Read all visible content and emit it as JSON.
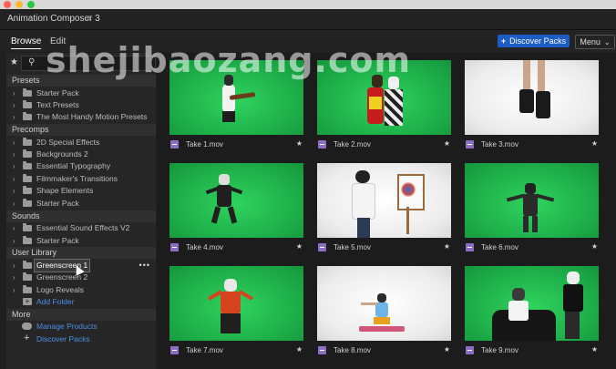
{
  "window": {
    "title": "Animation Composer 3",
    "menu_icon": "hamburger-icon"
  },
  "tabs": [
    {
      "label": "Browse",
      "active": true
    },
    {
      "label": "Edit",
      "active": false
    }
  ],
  "header": {
    "discover_label": "Discover Packs",
    "menu_label": "Menu"
  },
  "sidebar": {
    "sections": {
      "presets": "Presets",
      "precomps": "Precomps",
      "sounds": "Sounds",
      "user_library": "User Library",
      "more": "More"
    },
    "presets": [
      "Starter Pack",
      "Text Presets",
      "The Most Handy Motion Presets"
    ],
    "precomps": [
      "2D Special Effects",
      "Backgrounds 2",
      "Essential Typography",
      "Filmmaker's Transitions",
      "Shape Elements",
      "Starter Pack"
    ],
    "sounds": [
      "Essential Sound Effects V2",
      "Starter Pack"
    ],
    "user_library": [
      "Greenscreen 1",
      "Greenscreen 2",
      "Logo Reveals"
    ],
    "add_folder": "Add Folder",
    "more": [
      "Manage Products",
      "Discover Packs"
    ],
    "item_more": "•••"
  },
  "videos": [
    {
      "label": "Take 1.mov",
      "bg": "green"
    },
    {
      "label": "Take 2.mov",
      "bg": "green"
    },
    {
      "label": "Take 3.mov",
      "bg": "white"
    },
    {
      "label": "Take 4.mov",
      "bg": "green"
    },
    {
      "label": "Take 5.mov",
      "bg": "white"
    },
    {
      "label": "Take 6.mov",
      "bg": "green"
    },
    {
      "label": "Take 7.mov",
      "bg": "green"
    },
    {
      "label": "Take 8.mov",
      "bg": "white"
    },
    {
      "label": "Take 9.mov",
      "bg": "green"
    }
  ],
  "watermark": "shejibaozang.com",
  "colors": {
    "accent": "#1c5cc4",
    "link": "#4b8fe8",
    "video_badge": "#8c6fc4",
    "green_screen": "#22b84e"
  }
}
